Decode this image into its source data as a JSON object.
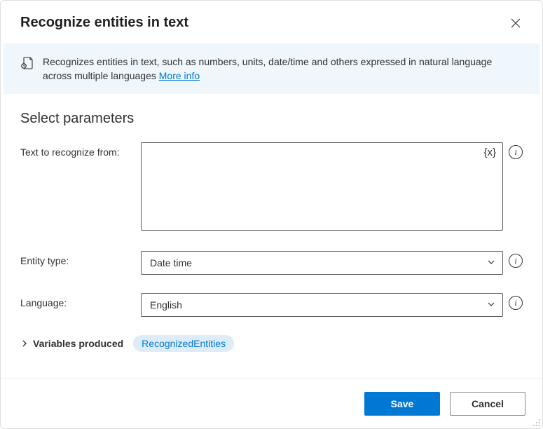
{
  "header": {
    "title": "Recognize entities in text"
  },
  "banner": {
    "text": "Recognizes entities in text, such as numbers, units, date/time and others expressed in natural language across multiple languages ",
    "more_info": "More info"
  },
  "section": {
    "title": "Select parameters"
  },
  "fields": {
    "text_recognize": {
      "label": "Text to recognize from:",
      "value": "",
      "var_token": "{x}"
    },
    "entity_type": {
      "label": "Entity type:",
      "value": "Date time"
    },
    "language": {
      "label": "Language:",
      "value": "English"
    }
  },
  "variables": {
    "label": "Variables produced",
    "pill": "RecognizedEntities"
  },
  "footer": {
    "save": "Save",
    "cancel": "Cancel"
  }
}
